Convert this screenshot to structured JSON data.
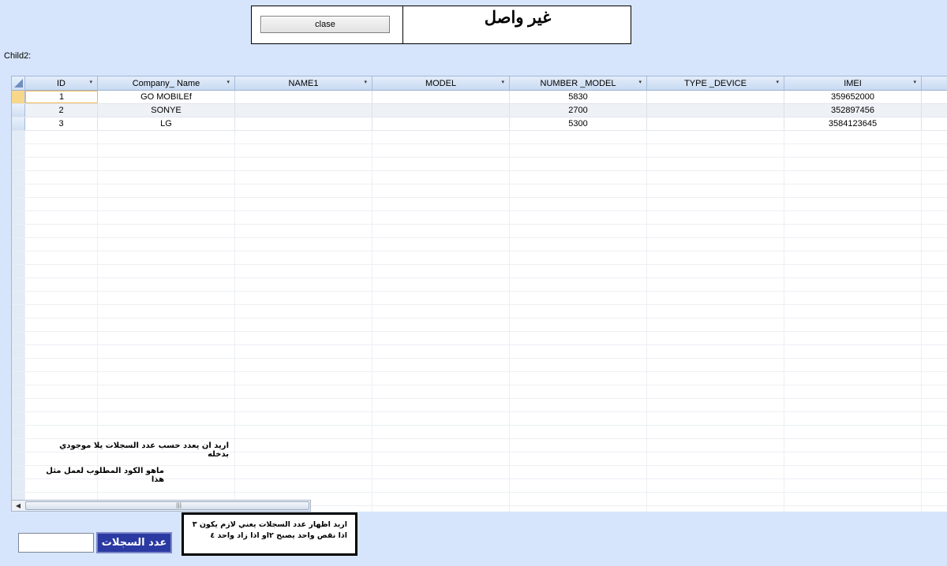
{
  "header": {
    "close_label": "clase",
    "status_title": "غير واصل"
  },
  "child_label": "Child2:",
  "grid": {
    "columns": [
      {
        "name": "id",
        "label": "ID",
        "dropdown": true
      },
      {
        "name": "company-name",
        "label": "Company_ Name",
        "dropdown": true
      },
      {
        "name": "name1",
        "label": "NAME1",
        "dropdown": true
      },
      {
        "name": "model",
        "label": "MODEL",
        "dropdown": true
      },
      {
        "name": "number-model",
        "label": "NUMBER _MODEL",
        "dropdown": true
      },
      {
        "name": "type-device",
        "label": "TYPE _DEVICE",
        "dropdown": true
      },
      {
        "name": "imei",
        "label": "IMEI",
        "dropdown": true
      }
    ],
    "rows": [
      [
        "1",
        "GO MOBILEf",
        "",
        "",
        "5830",
        "",
        "359652000"
      ],
      [
        "2",
        "SONYE",
        "",
        "",
        "2700",
        "",
        "352897456"
      ],
      [
        "3",
        "LG",
        "",
        "",
        "5300",
        "",
        "3584123645"
      ]
    ],
    "note_line1": "اريد ان يعدد حسب عدد السجلات يلا موجودي  بدخله",
    "note_line2": "ماهو الكود المطلوب لعمل مثل هذا"
  },
  "footer": {
    "count_button_label": "عدد السجلات",
    "count_value": "",
    "note_line1": "اريد اظهار عدد السجلات يعني لازم يكون ٣",
    "note_line2": "اذا نقص واحد يصبح ٢او اذا زاد واحد ٤"
  }
}
